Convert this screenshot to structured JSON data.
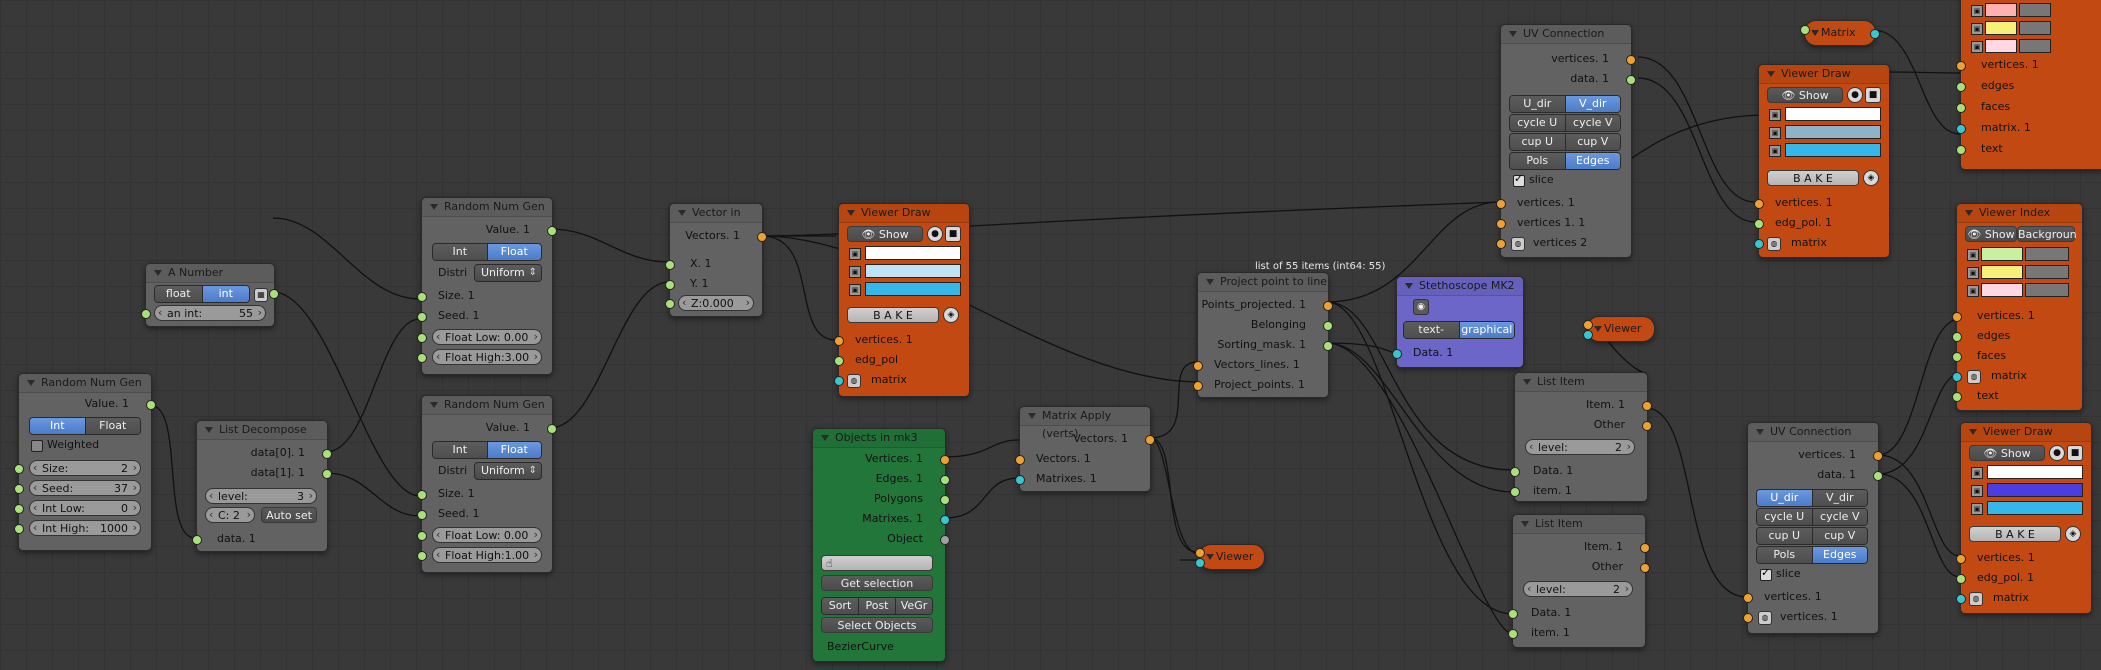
{
  "colors": {
    "orange": "#c24a12",
    "green": "#23763a",
    "purple": "#6d66c9",
    "gray": "#626262",
    "select": "#4c7cc8"
  },
  "random_num_gen_1": {
    "title": "Random Num Gen",
    "out": "Value. 1",
    "modes": [
      "Int",
      "Float"
    ],
    "weighted": "Weighted",
    "size_lbl": "Size:",
    "size_val": "2",
    "seed_lbl": "Seed:",
    "seed_val": "37",
    "low_lbl": "Int Low:",
    "low_val": "0",
    "high_lbl": "Int High:",
    "high_val": "1000",
    "in": "data. 1"
  },
  "list_decompose": {
    "title": "List Decompose",
    "out0": "data[0]. 1",
    "out1": "data[1]. 1",
    "level_lbl": "level:",
    "level_val": "3",
    "c_lbl": "C: 2",
    "auto": "Auto set",
    "in": "data. 1"
  },
  "a_number": {
    "title": "A Number",
    "modes": [
      "float",
      "int"
    ],
    "field": "an int:",
    "field_val": "55"
  },
  "random_num_gen_2": {
    "title": "Random Num Gen",
    "out": "Value. 1",
    "modes": [
      "Int",
      "Float"
    ],
    "distri_lbl": "Distri",
    "distri_val": "Uniform",
    "size": "Size. 1",
    "seed": "Seed. 1",
    "flow": "Float Low: 0.00",
    "fhigh": "Float High:3.00"
  },
  "random_num_gen_3": {
    "title": "Random Num Gen",
    "out": "Value. 1",
    "modes": [
      "Int",
      "Float"
    ],
    "distri_lbl": "Distri",
    "distri_val": "Uniform",
    "size": "Size. 1",
    "seed": "Seed. 1",
    "flow": "Float Low: 0.00",
    "fhigh": "Float High:1.00"
  },
  "vector_in": {
    "title": "Vector in",
    "out": "Vectors. 1",
    "x": "X. 1",
    "y": "Y. 1",
    "z": "Z:0.000"
  },
  "viewer_draw_1": {
    "title": "Viewer Draw",
    "show": "Show",
    "bake": "B A K E",
    "in_vertices": "vertices. 1",
    "in_edgpol": "edg_pol",
    "in_matrix": "matrix",
    "sw": [
      "#ffffff",
      "#bfe3f5",
      "#35b7ea"
    ]
  },
  "objects_in": {
    "title": "Objects in mk3",
    "vertices": "Vertices. 1",
    "edges": "Edges. 1",
    "polygons": "Polygons",
    "matrixes": "Matrixes. 1",
    "object": "Object",
    "get_sel": "Get selection",
    "sort": [
      "Sort",
      "Post",
      "VeGr"
    ],
    "select": "Select Objects",
    "item": "BezierCurve"
  },
  "matrix_apply": {
    "title": "Matrix Apply (verts)",
    "out": "Vectors. 1",
    "in_v": "Vectors. 1",
    "in_m": "Matrixes. 1"
  },
  "viewer_1": {
    "title": "Viewer"
  },
  "project_point": {
    "title": "Project point to line",
    "info": "list of 55 items (int64: 55)",
    "o1": "Points_projected. 1",
    "o2": "Belonging",
    "o3": "Sorting_mask. 1",
    "i1": "Vectors_lines. 1",
    "i2": "Project_points. 1"
  },
  "stethoscope": {
    "title": "Stethoscope MK2",
    "modes": [
      "text-based",
      "graphical"
    ],
    "in": "Data. 1"
  },
  "uv_connection_1": {
    "title": "UV Connection",
    "o1": "vertices. 1",
    "o2": "data. 1",
    "grid": [
      [
        "U_dir",
        "V_dir"
      ],
      [
        "cycle U",
        "cycle V"
      ],
      [
        "cup U",
        "cup V"
      ],
      [
        "Pols",
        "Edges"
      ]
    ],
    "slice": "slice",
    "i1": "vertices. 1",
    "i2": "vertices 1. 1",
    "i3": "vertices 2"
  },
  "viewer_2": {
    "title": "Viewer"
  },
  "list_item_1": {
    "title": "List Item",
    "o1": "Item. 1",
    "o2": "Other",
    "level_lbl": "level:",
    "level_val": "2",
    "i1": "Data. 1",
    "i2": "item. 1"
  },
  "list_item_2": {
    "title": "List Item",
    "o1": "Item. 1",
    "o2": "Other",
    "level_lbl": "level:",
    "level_val": "2",
    "i1": "Data. 1",
    "i2": "item. 1"
  },
  "matrix_node": {
    "title": "Matrix"
  },
  "viewer_draw_2": {
    "title": "Viewer Draw",
    "show": "Show",
    "bake": "B A K E",
    "i1": "vertices. 1",
    "i2": "edg_pol. 1",
    "i3": "matrix",
    "sw": [
      "#ffffff",
      "#8fb3c6",
      "#35b7ea"
    ]
  },
  "viewer_index_top": {
    "i1": "vertices. 1",
    "i2": "edges",
    "i3": "faces",
    "i4": "matrix. 1",
    "i5": "text",
    "sw": [
      "#ffb0b0",
      "#f6f07a",
      "#ffd8e4"
    ]
  },
  "viewer_index": {
    "title": "Viewer Index",
    "show": "Show",
    "bg": "Backgroun",
    "i1": "vertices. 1",
    "i2": "edges",
    "i3": "faces",
    "i4": "matrix",
    "i5": "text",
    "sw": [
      "#c8f0a0",
      "#f6f07a",
      "#ffd8e4"
    ]
  },
  "uv_connection_2": {
    "title": "UV Connection",
    "o1": "vertices. 1",
    "o2": "data. 1",
    "grid": [
      [
        "U_dir",
        "V_dir"
      ],
      [
        "cycle U",
        "cycle V"
      ],
      [
        "cup U",
        "cup V"
      ],
      [
        "Pols",
        "Edges"
      ]
    ],
    "slice": "slice",
    "i1": "vertices. 1",
    "i2": "vertices. 1"
  },
  "viewer_draw_3": {
    "title": "Viewer Draw",
    "show": "Show",
    "bake": "B A K E",
    "i1": "vertices. 1",
    "i2": "edg_pol. 1",
    "i3": "matrix",
    "sw": [
      "#ffffff",
      "#4b3ee0",
      "#35b7ea"
    ]
  }
}
